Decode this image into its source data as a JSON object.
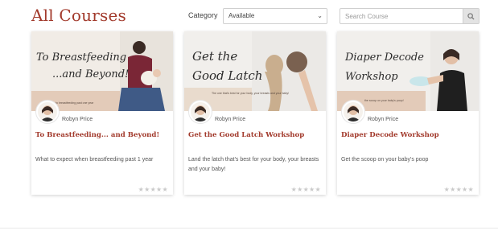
{
  "page": {
    "title": "All Courses"
  },
  "filter": {
    "category_label": "Category",
    "category_value": "Available",
    "search_placeholder": "Search Course"
  },
  "courses": [
    {
      "banner_text_line1": "To Breastfeeding",
      "banner_text_line2": "...and Beyond!",
      "banner_caption": "to breastfeeding past one year",
      "author": "Robyn Price",
      "title": "To Breastfeeding... and Beyond!",
      "description": "What to expect when breastfeeding past 1 year",
      "rating": "★★★★★"
    },
    {
      "banner_text_line1": "Get the",
      "banner_text_line2": "Good Latch",
      "banner_caption": "The one that's best for your body, your breasts and your baby!",
      "author": "Robyn Price",
      "title": "Get the Good Latch Workshop",
      "description": "Land the latch that's best for your body, your breasts and your baby!",
      "rating": "★★★★★"
    },
    {
      "banner_text_line1": "Diaper Decode",
      "banner_text_line2": "Workshop",
      "banner_caption": "the scoop on your baby's poop!",
      "author": "Robyn Price",
      "title": "Diaper Decode Workshop",
      "description": "Get the scoop on your baby's poop",
      "rating": "★★★★★"
    }
  ],
  "colors": {
    "accent": "#a23a2c",
    "star": "#c9c9c9"
  }
}
